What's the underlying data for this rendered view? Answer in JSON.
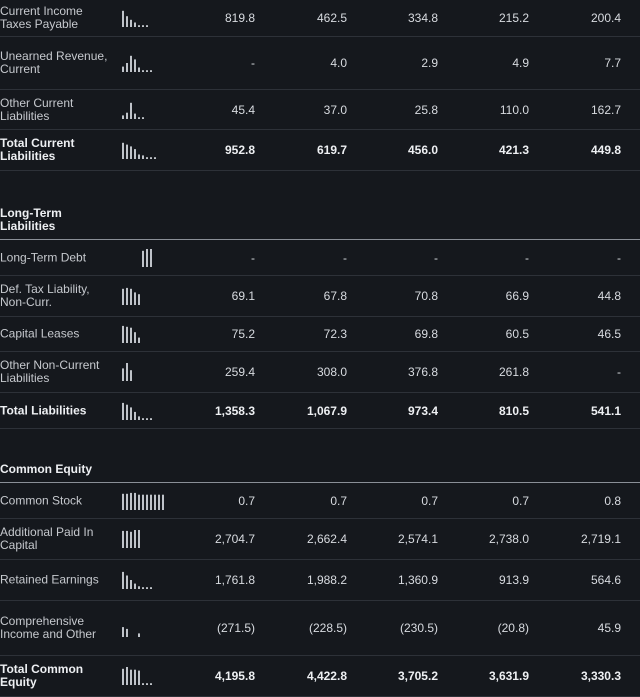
{
  "colors": {
    "background": "#15181d",
    "sparkline": "#bfc3c9",
    "divider": "#2d3138"
  },
  "sections": [
    {
      "title": "",
      "rows": [
        {
          "label": "Current Income Taxes Payable",
          "values": [
            "819.8",
            "462.5",
            "334.8",
            "215.2",
            "200.4"
          ],
          "total": false,
          "spark": [
            0.9,
            0.6,
            0.4,
            0.25,
            0.1,
            0.1,
            0.1
          ]
        },
        {
          "label": "Unearned Revenue, Current",
          "values": [
            "-",
            "4.0",
            "2.9",
            "4.9",
            "7.7"
          ],
          "total": false,
          "spark": [
            0.3,
            0.5,
            0.9,
            0.7,
            0.25,
            0.1,
            0.1,
            0.1
          ]
        },
        {
          "label": "Other Current Liabilities",
          "values": [
            "45.4",
            "37.0",
            "25.8",
            "110.0",
            "162.7"
          ],
          "total": false,
          "spark": [
            0.2,
            0.35,
            0.9,
            0.3,
            0.1,
            0.1
          ]
        },
        {
          "label": "Total Current Liabilities",
          "values": [
            "952.8",
            "619.7",
            "456.0",
            "421.3",
            "449.8"
          ],
          "total": true,
          "spark": [
            0.9,
            0.8,
            0.7,
            0.55,
            0.25,
            0.2,
            0.1,
            0.1,
            0.1
          ]
        }
      ]
    },
    {
      "title": "Long-Term Liabilities",
      "rows": [
        {
          "label": "Long-Term Debt",
          "values": [
            "-",
            "-",
            "-",
            "-",
            "-"
          ],
          "total": false,
          "spark": [
            0,
            0,
            0,
            0,
            0,
            0.9,
            1.0,
            1.0
          ]
        },
        {
          "label": "Def. Tax Liability, Non-Curr.",
          "values": [
            "69.1",
            "67.8",
            "70.8",
            "66.9",
            "44.8"
          ],
          "total": false,
          "spark": [
            0.9,
            0.95,
            0.9,
            0.7,
            0.6
          ]
        },
        {
          "label": "Capital Leases",
          "values": [
            "75.2",
            "72.3",
            "69.8",
            "60.5",
            "46.5"
          ],
          "total": false,
          "spark": [
            0.95,
            0.9,
            0.85,
            0.6,
            0.3
          ]
        },
        {
          "label": "Other Non-Current Liabilities",
          "values": [
            "259.4",
            "308.0",
            "376.8",
            "261.8",
            "-"
          ],
          "total": false,
          "spark": [
            0.7,
            1.0,
            0.6
          ]
        },
        {
          "label": "Total Liabilities",
          "values": [
            "1,358.3",
            "1,067.9",
            "973.4",
            "810.5",
            "541.1"
          ],
          "total": true,
          "spark": [
            0.95,
            0.85,
            0.7,
            0.45,
            0.2,
            0.1,
            0.1,
            0.1
          ]
        }
      ]
    },
    {
      "title": "Common Equity",
      "rows": [
        {
          "label": "Common Stock",
          "values": [
            "0.7",
            "0.7",
            "0.7",
            "0.7",
            "0.8"
          ],
          "total": false,
          "spark": [
            0.9,
            0.9,
            0.95,
            0.95,
            0.85,
            0.85,
            0.85,
            0.85,
            0.85,
            0.85,
            0.85
          ]
        },
        {
          "label": "Additional Paid In Capital",
          "values": [
            "2,704.7",
            "2,662.4",
            "2,574.1",
            "2,738.0",
            "2,719.1"
          ],
          "total": false,
          "spark": [
            0.95,
            0.95,
            0.9,
            1.0,
            1.0
          ]
        },
        {
          "label": "Retained Earnings",
          "values": [
            "1,761.8",
            "1,988.2",
            "1,360.9",
            "913.9",
            "564.6"
          ],
          "total": false,
          "spark": [
            0.95,
            0.75,
            0.5,
            0.3,
            0.15,
            0.1,
            0.1,
            0.1
          ]
        },
        {
          "label": "Comprehensive Income and Other",
          "values": [
            "(271.5)",
            "(228.5)",
            "(230.5)",
            "(20.8)",
            "45.9"
          ],
          "total": false,
          "spark": [
            0.55,
            0.45,
            0,
            0,
            0.2
          ]
        },
        {
          "label": "Total Common Equity",
          "values": [
            "4,195.8",
            "4,422.8",
            "3,705.2",
            "3,631.9",
            "3,330.3"
          ],
          "total": true,
          "spark": [
            0.9,
            1.0,
            0.85,
            0.85,
            0.8,
            0.1,
            0.1,
            0.1
          ]
        }
      ]
    }
  ]
}
